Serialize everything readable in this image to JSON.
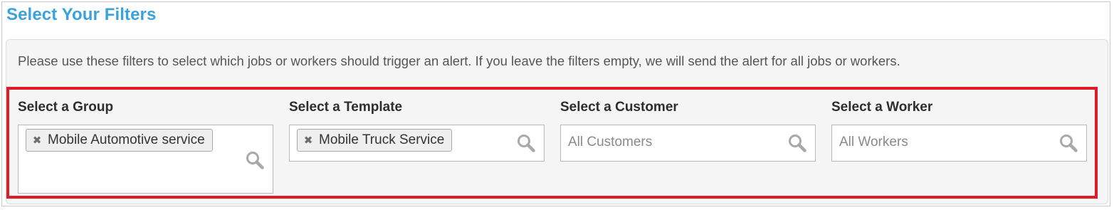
{
  "page": {
    "title": "Select Your Filters",
    "intro": "Please use these filters to select which jobs or workers should trigger an alert. If you leave the filters empty, we will send the alert for all jobs or workers."
  },
  "filters": {
    "group": {
      "label": "Select a Group",
      "selected": [
        "Mobile Automotive service"
      ],
      "remove_glyph": "✖",
      "icon": "search-icon"
    },
    "template": {
      "label": "Select a Template",
      "selected": [
        "Mobile Truck Service"
      ],
      "remove_glyph": "✖",
      "icon": "search-icon"
    },
    "customer": {
      "label": "Select a Customer",
      "placeholder": "All Customers",
      "icon": "search-icon"
    },
    "worker": {
      "label": "Select a Worker",
      "placeholder": "All Workers",
      "icon": "search-icon"
    }
  },
  "colors": {
    "title": "#3aa2dc",
    "highlight_border": "#e01b24",
    "panel_background": "#f5f5f5",
    "placeholder_text": "#8a8a8a"
  }
}
